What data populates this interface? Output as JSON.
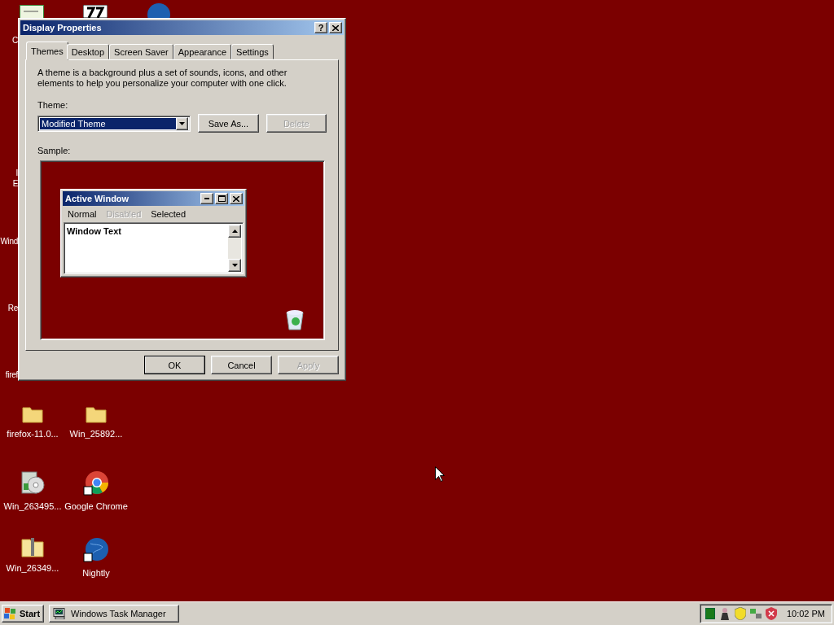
{
  "desktop": {
    "partial_labels": [
      "C",
      "I",
      "E",
      "Wind",
      "Re",
      "firef"
    ],
    "icons": [
      {
        "label": "firefox-11.0...",
        "kind": "folder"
      },
      {
        "label": "Win_25892...",
        "kind": "folder"
      },
      {
        "label": "Win_263495...",
        "kind": "installer"
      },
      {
        "label": "Google Chrome",
        "kind": "chrome"
      },
      {
        "label": "Win_26349...",
        "kind": "zip"
      },
      {
        "label": "Nightly",
        "kind": "globe"
      }
    ]
  },
  "dialog": {
    "title": "Display Properties",
    "help_button": "?",
    "tabs": [
      {
        "label": "Themes",
        "selected": true
      },
      {
        "label": "Desktop",
        "selected": false
      },
      {
        "label": "Screen Saver",
        "selected": false
      },
      {
        "label": "Appearance",
        "selected": false
      },
      {
        "label": "Settings",
        "selected": false
      }
    ],
    "description": "A theme is a background plus a set of sounds, icons, and other elements to help you personalize your computer with one click.",
    "theme_label": "Theme:",
    "theme_select": {
      "value": "Modified Theme"
    },
    "theme_buttons": [
      {
        "label": "Save As...",
        "disabled": false
      },
      {
        "label": "Delete",
        "disabled": true
      }
    ],
    "sample_label": "Sample:",
    "sample": {
      "window_title": "Active Window",
      "menu": [
        {
          "label": "Normal",
          "disabled": false
        },
        {
          "label": "Disabled",
          "disabled": true
        },
        {
          "label": "Selected",
          "disabled": false
        }
      ],
      "window_text": "Window Text"
    },
    "footer_buttons": [
      {
        "label": "OK",
        "default": true,
        "disabled": false
      },
      {
        "label": "Cancel",
        "default": false,
        "disabled": false
      },
      {
        "label": "Apply",
        "default": false,
        "disabled": true
      }
    ]
  },
  "taskbar": {
    "start": "Start",
    "tasks": [
      {
        "label": "Windows Task Manager"
      }
    ],
    "clock": "10:02 PM"
  }
}
